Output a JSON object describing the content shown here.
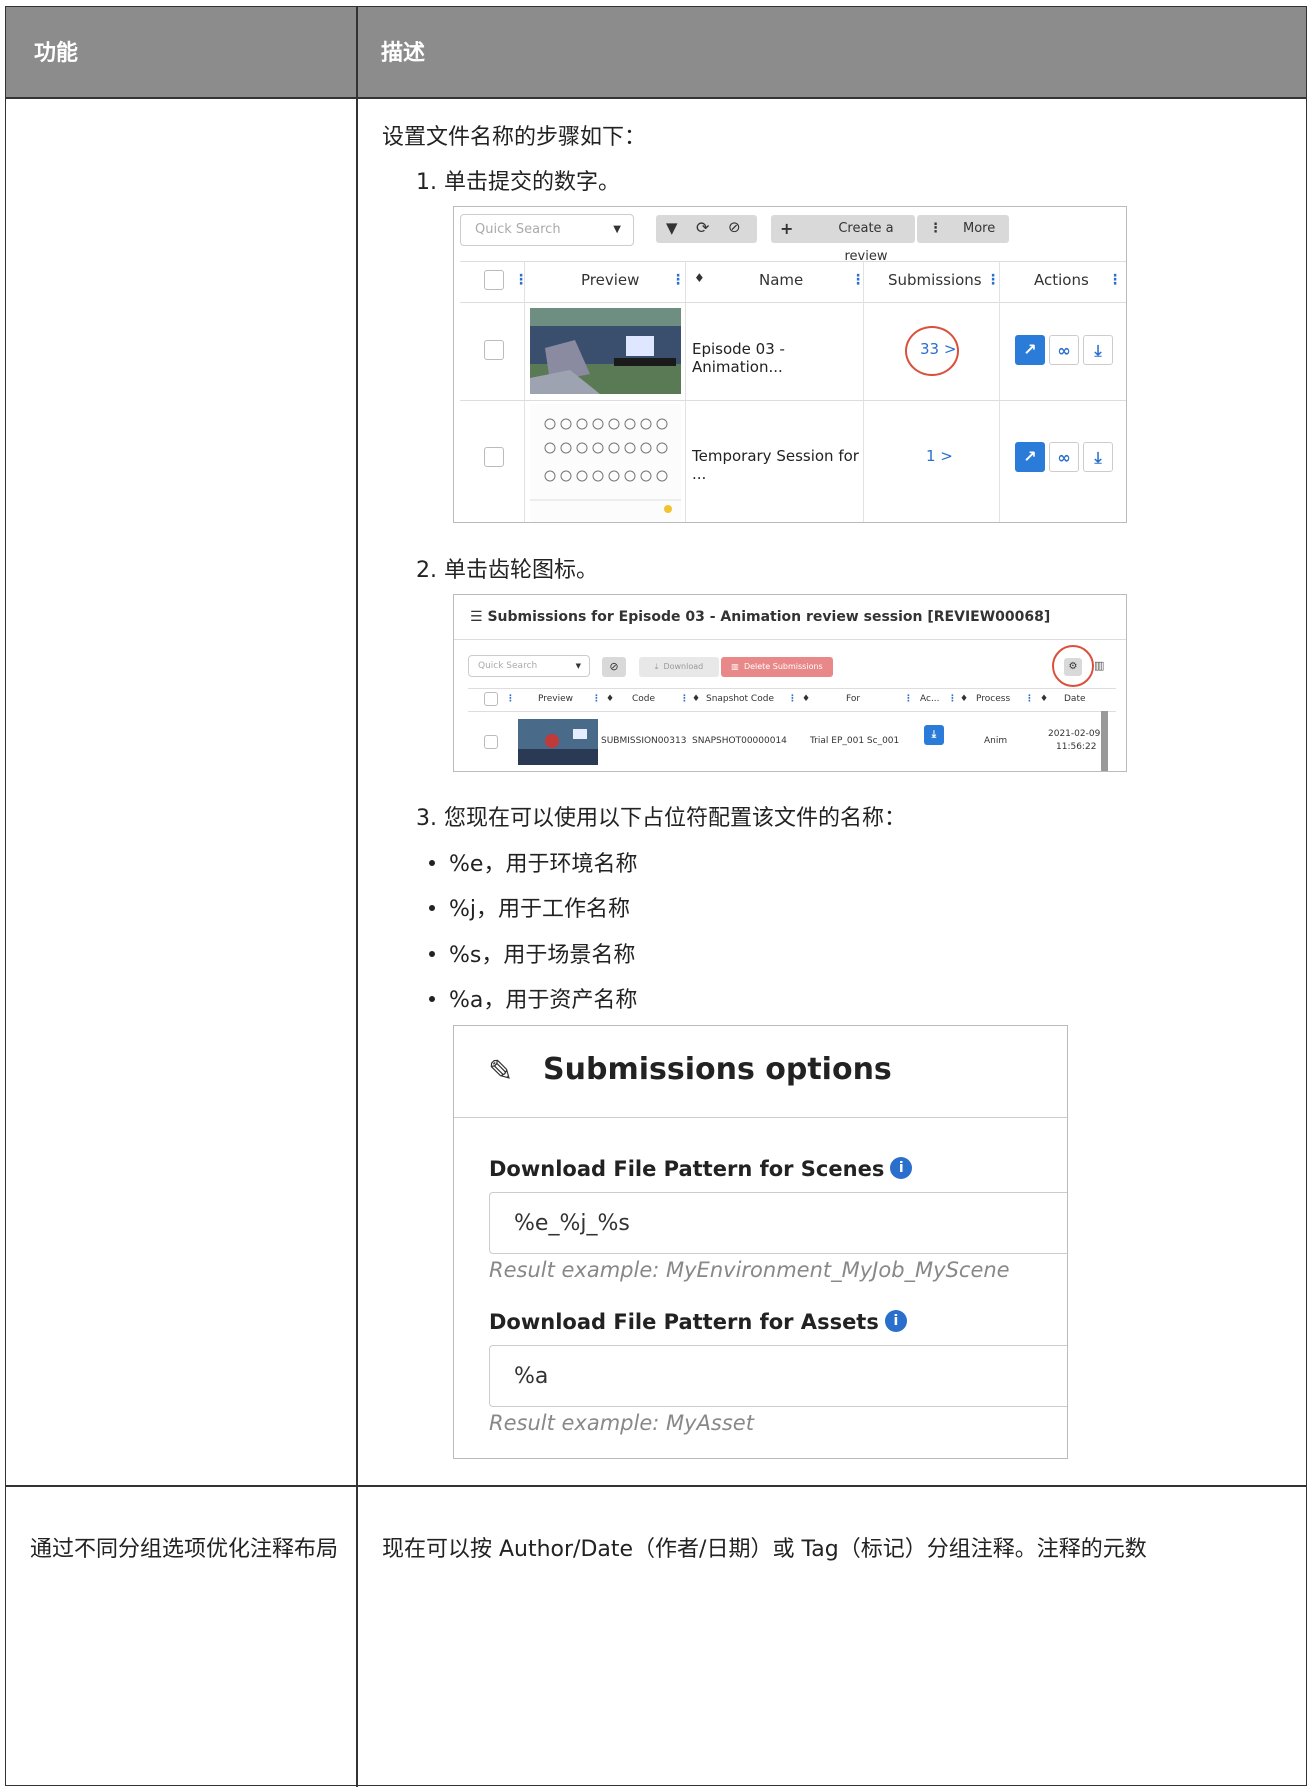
{
  "table": {
    "headers": {
      "feature": "功能",
      "description": "描述"
    },
    "row1": {
      "intro": "设置文件名称的步骤如下：",
      "steps": [
        "1. 单击提交的数字。",
        "2. 单击齿轮图标。",
        "3. 您现在可以使用以下占位符配置该文件的名称："
      ],
      "bullets": [
        "%e，用于环境名称",
        "%j，用于工作名称",
        "%s，用于场景名称",
        "%a，用于资产名称"
      ]
    },
    "row2": {
      "feature": "通过不同分组选项优化注释布局",
      "description": "现在可以按 Author/Date（作者/日期）或 Tag（标记）分组注释。注释的元数"
    }
  },
  "screenshot1": {
    "search_placeholder": "Quick Search",
    "create_review": "Create a review",
    "more": "More",
    "columns": [
      "Preview",
      "Name",
      "Submissions",
      "Actions"
    ],
    "rows": [
      {
        "name": "Episode 03 - Animation...",
        "submissions": "33 >"
      },
      {
        "name": "Temporary Session for ...",
        "submissions": "1 >"
      }
    ]
  },
  "screenshot2": {
    "title": "Submissions for Episode 03 - Animation review session [REVIEW00068]",
    "search_placeholder": "Quick Search",
    "download": "Download",
    "delete": "Delete Submissions",
    "columns": [
      "Preview",
      "Code",
      "Snapshot Code",
      "For",
      "Ac...",
      "Process",
      "Date"
    ],
    "row": {
      "code": "SUBMISSION00313",
      "snapshot": "SNAPSHOT00000014",
      "for": "Trial EP_001 Sc_001",
      "process": "Anim",
      "date": "2021-02-09",
      "time": "11:56:22"
    }
  },
  "screenshot3": {
    "title": "Submissions options",
    "scenes_label": "Download File Pattern for Scenes",
    "scenes_value": "%e_%j_%s",
    "scenes_hint": "Result example: MyEnvironment_MyJob_MyScene",
    "assets_label": "Download File Pattern for Assets",
    "assets_value": "%a",
    "assets_hint": "Result example: MyAsset"
  }
}
